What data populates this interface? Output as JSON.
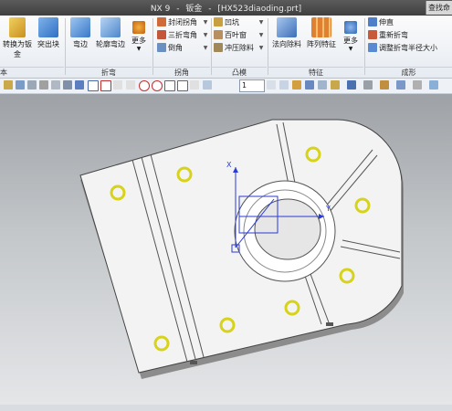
{
  "window": {
    "app_name": "NX 9",
    "separator": "-",
    "module": "钣金",
    "file": "[HX523diaoding.prt]",
    "search_label": "查找命"
  },
  "ribbon": {
    "buttons": {
      "convert": "转换为钣金",
      "tab": "突出块",
      "flange": "弯边",
      "contour_flange": "轮廓弯边",
      "more1": "更多",
      "normal_cutout": "法向除料",
      "pattern_feature": "阵列特征",
      "more2": "更多"
    },
    "small": {
      "closed_corner": "封闭拐角",
      "three_bend_corner": "三折弯角",
      "chamfer": "倒角",
      "dimple": "凹坑",
      "louver": "百叶窗",
      "punch": "冲压除料",
      "unbend": "伸直",
      "rebend": "重新折弯",
      "resize_bend_radius": "调整折弯半径大小"
    },
    "groups": {
      "base": "本",
      "bend": "折弯",
      "corner": "拐角",
      "emboss": "凸模",
      "feature": "特征",
      "form": "成形"
    }
  },
  "toolbar": {
    "layer_value": "1"
  },
  "icons": [
    "box-icon",
    "tab-icon",
    "flange-icon",
    "contour-flange-icon",
    "gear-icon",
    "normal-cutout-icon",
    "pattern-icon",
    "more-icon",
    "fit-icon",
    "zoom-icon",
    "rotate-icon",
    "pan-icon",
    "shaded-icon",
    "wireframe-icon",
    "snap-icon"
  ],
  "colors": {
    "titlebar": "#4a4a4a",
    "part_face": "#f3f3f3",
    "hole_fill": "#d7d21a",
    "csys_x": "#2b3bd6",
    "viewport_top": "#9ea2a6",
    "viewport_bottom": "#e4e6e8"
  }
}
